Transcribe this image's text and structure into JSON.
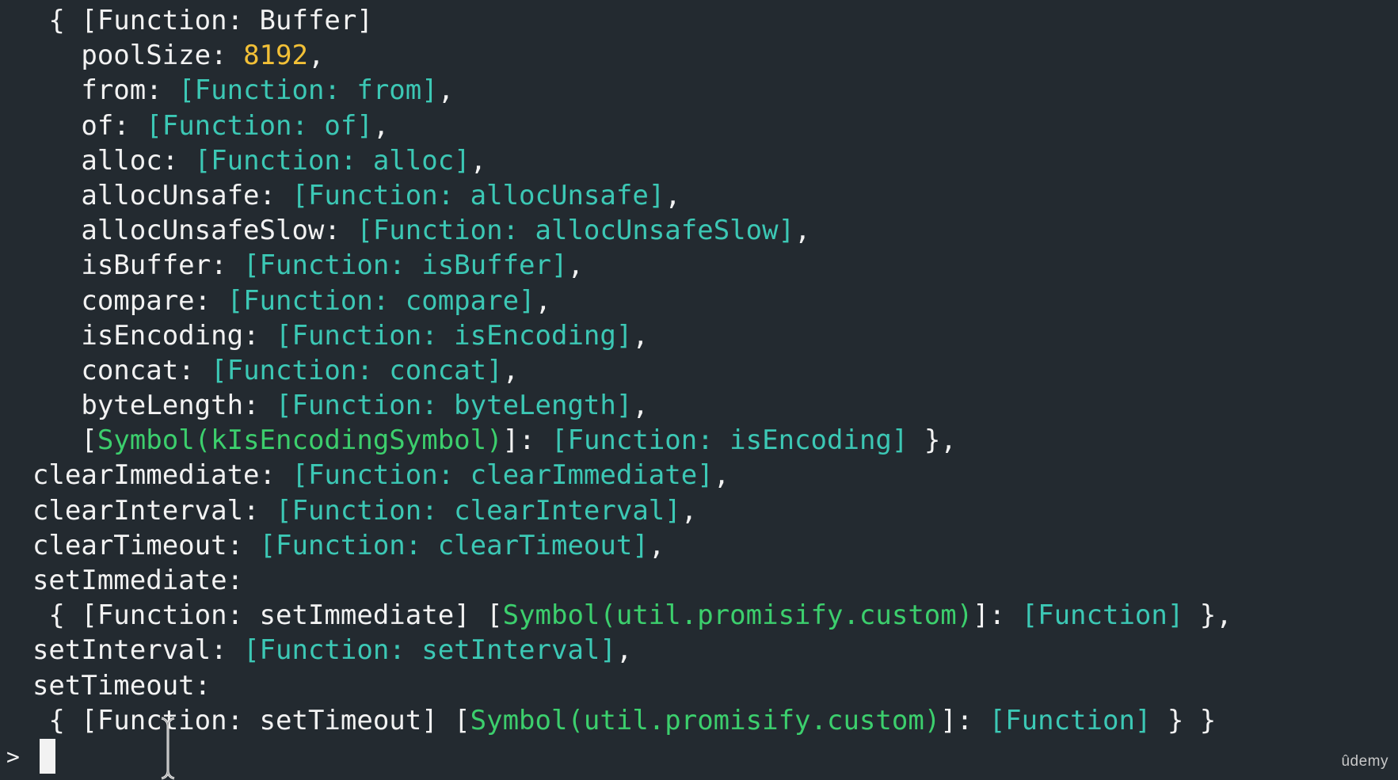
{
  "terminal": {
    "lines": [
      {
        "indent": 3,
        "segments": [
          {
            "t": "{ [Function: Buffer]",
            "c": "default"
          }
        ]
      },
      {
        "indent": 5,
        "segments": [
          {
            "t": "poolSize: ",
            "c": "default"
          },
          {
            "t": "8192",
            "c": "number"
          },
          {
            "t": ",",
            "c": "default"
          }
        ]
      },
      {
        "indent": 5,
        "segments": [
          {
            "t": "from: ",
            "c": "default"
          },
          {
            "t": "[Function: from]",
            "c": "func"
          },
          {
            "t": ",",
            "c": "default"
          }
        ]
      },
      {
        "indent": 5,
        "segments": [
          {
            "t": "of: ",
            "c": "default"
          },
          {
            "t": "[Function: of]",
            "c": "func"
          },
          {
            "t": ",",
            "c": "default"
          }
        ]
      },
      {
        "indent": 5,
        "segments": [
          {
            "t": "alloc: ",
            "c": "default"
          },
          {
            "t": "[Function: alloc]",
            "c": "func"
          },
          {
            "t": ",",
            "c": "default"
          }
        ]
      },
      {
        "indent": 5,
        "segments": [
          {
            "t": "allocUnsafe: ",
            "c": "default"
          },
          {
            "t": "[Function: allocUnsafe]",
            "c": "func"
          },
          {
            "t": ",",
            "c": "default"
          }
        ]
      },
      {
        "indent": 5,
        "segments": [
          {
            "t": "allocUnsafeSlow: ",
            "c": "default"
          },
          {
            "t": "[Function: allocUnsafeSlow]",
            "c": "func"
          },
          {
            "t": ",",
            "c": "default"
          }
        ]
      },
      {
        "indent": 5,
        "segments": [
          {
            "t": "isBuffer: ",
            "c": "default"
          },
          {
            "t": "[Function: isBuffer]",
            "c": "func"
          },
          {
            "t": ",",
            "c": "default"
          }
        ]
      },
      {
        "indent": 5,
        "segments": [
          {
            "t": "compare: ",
            "c": "default"
          },
          {
            "t": "[Function: compare]",
            "c": "func"
          },
          {
            "t": ",",
            "c": "default"
          }
        ]
      },
      {
        "indent": 5,
        "segments": [
          {
            "t": "isEncoding: ",
            "c": "default"
          },
          {
            "t": "[Function: isEncoding]",
            "c": "func"
          },
          {
            "t": ",",
            "c": "default"
          }
        ]
      },
      {
        "indent": 5,
        "segments": [
          {
            "t": "concat: ",
            "c": "default"
          },
          {
            "t": "[Function: concat]",
            "c": "func"
          },
          {
            "t": ",",
            "c": "default"
          }
        ]
      },
      {
        "indent": 5,
        "segments": [
          {
            "t": "byteLength: ",
            "c": "default"
          },
          {
            "t": "[Function: byteLength]",
            "c": "func"
          },
          {
            "t": ",",
            "c": "default"
          }
        ]
      },
      {
        "indent": 5,
        "segments": [
          {
            "t": "[",
            "c": "default"
          },
          {
            "t": "Symbol(kIsEncodingSymbol)",
            "c": "symbol"
          },
          {
            "t": "]: ",
            "c": "default"
          },
          {
            "t": "[Function: isEncoding]",
            "c": "func"
          },
          {
            "t": " },",
            "c": "default"
          }
        ]
      },
      {
        "indent": 2,
        "segments": [
          {
            "t": "clearImmediate: ",
            "c": "default"
          },
          {
            "t": "[Function: clearImmediate]",
            "c": "func"
          },
          {
            "t": ",",
            "c": "default"
          }
        ]
      },
      {
        "indent": 2,
        "segments": [
          {
            "t": "clearInterval: ",
            "c": "default"
          },
          {
            "t": "[Function: clearInterval]",
            "c": "func"
          },
          {
            "t": ",",
            "c": "default"
          }
        ]
      },
      {
        "indent": 2,
        "segments": [
          {
            "t": "clearTimeout: ",
            "c": "default"
          },
          {
            "t": "[Function: clearTimeout]",
            "c": "func"
          },
          {
            "t": ",",
            "c": "default"
          }
        ]
      },
      {
        "indent": 2,
        "segments": [
          {
            "t": "setImmediate:",
            "c": "default"
          }
        ]
      },
      {
        "indent": 3,
        "segments": [
          {
            "t": "{ [Function: setImmediate] [",
            "c": "default"
          },
          {
            "t": "Symbol(util.promisify.custom)",
            "c": "symbol"
          },
          {
            "t": "]: ",
            "c": "default"
          },
          {
            "t": "[Function]",
            "c": "func"
          },
          {
            "t": " },",
            "c": "default"
          }
        ]
      },
      {
        "indent": 2,
        "segments": [
          {
            "t": "setInterval: ",
            "c": "default"
          },
          {
            "t": "[Function: setInterval]",
            "c": "func"
          },
          {
            "t": ",",
            "c": "default"
          }
        ]
      },
      {
        "indent": 2,
        "segments": [
          {
            "t": "setTimeout:",
            "c": "default"
          }
        ]
      },
      {
        "indent": 3,
        "segments": [
          {
            "t": "{ [Function: setTimeout] [",
            "c": "default"
          },
          {
            "t": "Symbol(util.promisify.custom)",
            "c": "symbol"
          },
          {
            "t": "]: ",
            "c": "default"
          },
          {
            "t": "[Function]",
            "c": "func"
          },
          {
            "t": " } }",
            "c": "default"
          }
        ]
      }
    ],
    "prompt": ">",
    "input_value": ""
  },
  "watermark": "ûdemy",
  "colors": {
    "background": "#232a30",
    "default_text": "#f2f2f2",
    "function_text": "#3cc8b5",
    "symbol_text": "#3ccf6d",
    "number_text": "#f2c037"
  },
  "icons": {
    "cursor": "text-ibeam-cursor-icon",
    "caret": "block-caret-icon"
  }
}
